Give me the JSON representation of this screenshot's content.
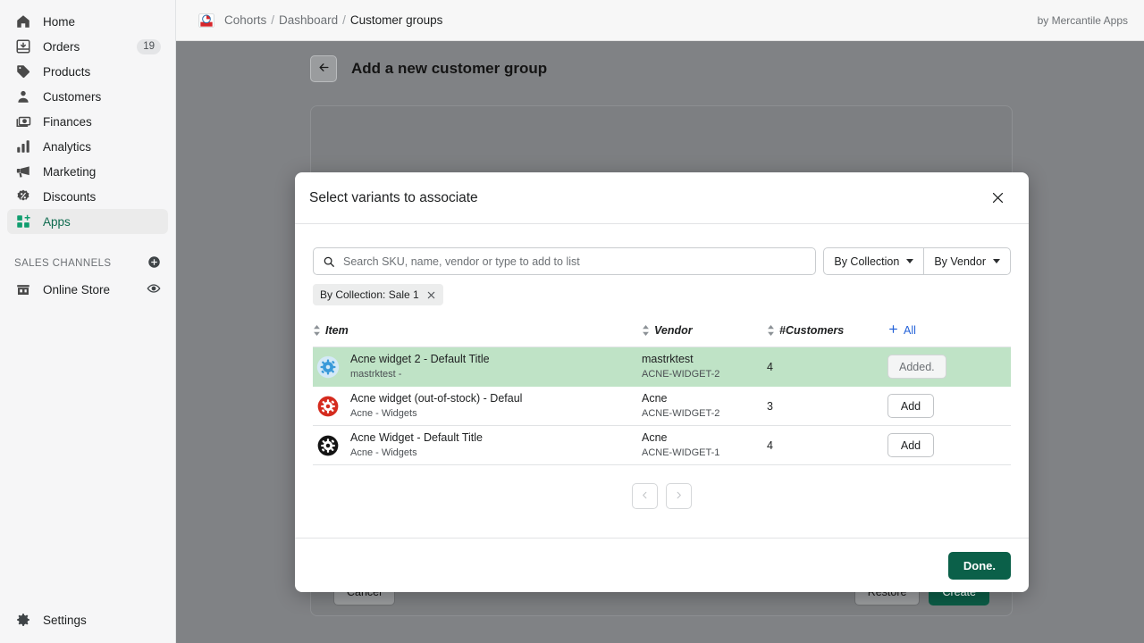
{
  "sidebar": {
    "items": [
      {
        "label": "Home",
        "icon": "home-icon",
        "badge": ""
      },
      {
        "label": "Orders",
        "icon": "orders-inbox-icon",
        "badge": "19"
      },
      {
        "label": "Products",
        "icon": "tag-icon",
        "badge": ""
      },
      {
        "label": "Customers",
        "icon": "person-icon",
        "badge": ""
      },
      {
        "label": "Finances",
        "icon": "banknote-icon",
        "badge": ""
      },
      {
        "label": "Analytics",
        "icon": "bar-chart-icon",
        "badge": ""
      },
      {
        "label": "Marketing",
        "icon": "megaphone-icon",
        "badge": ""
      },
      {
        "label": "Discounts",
        "icon": "discount-badge-icon",
        "badge": ""
      },
      {
        "label": "Apps",
        "icon": "apps-grid-plus-icon",
        "badge": ""
      }
    ],
    "section_label": "SALES CHANNELS",
    "channels": [
      {
        "label": "Online Store",
        "icon": "storefront-icon"
      }
    ],
    "settings": {
      "label": "Settings",
      "icon": "gear-icon"
    }
  },
  "topbar": {
    "brand_icon": "cohorts-logo-icon",
    "breadcrumb": {
      "root": "Cohorts",
      "middle": "Dashboard",
      "current": "Customer groups",
      "separator": "/"
    },
    "byline": "by Mercantile Apps"
  },
  "page": {
    "back_icon": "arrow-left-icon",
    "title": "Add a new customer group",
    "footer": {
      "cancel": "Cancel",
      "restore": "Restore",
      "create": "Create"
    }
  },
  "modal": {
    "title": "Select variants to associate",
    "close_icon": "close-icon",
    "search": {
      "placeholder": "Search SKU, name, vendor or type to add to list",
      "value": "",
      "icon": "search-icon"
    },
    "filters": [
      {
        "label": "By Collection",
        "icon": "chevron-down-icon"
      },
      {
        "label": "By Vendor",
        "icon": "chevron-down-icon"
      }
    ],
    "chips": [
      {
        "label": "By Collection: Sale 1",
        "remove_icon": "close-icon"
      }
    ],
    "table": {
      "columns": [
        {
          "key": "item",
          "label": "Item",
          "sortable": true
        },
        {
          "key": "vendor",
          "label": "Vendor",
          "sortable": true
        },
        {
          "key": "customers",
          "label": "#Customers",
          "sortable": true
        }
      ],
      "add_all": {
        "label": "All",
        "icon": "plus-icon"
      },
      "rows": [
        {
          "icon": "gear-icon",
          "icon_color": "#3a9ad9",
          "icon_bg": "#d4e9f7",
          "title": "Acne widget 2 - Default Title",
          "subtitle": "mastrktest -",
          "vendor": "mastrktest",
          "sku": "ACNE-WIDGET-2",
          "customers": "4",
          "action_label": "Added.",
          "added": true
        },
        {
          "icon": "gear-icon",
          "icon_color": "#ffffff",
          "icon_bg": "#d52b1e",
          "title": "Acne widget (out-of-stock) - Defaul",
          "subtitle": "Acne - Widgets",
          "vendor": "Acne",
          "sku": "ACNE-WIDGET-2",
          "customers": "3",
          "action_label": "Add",
          "added": false
        },
        {
          "icon": "gear-icon",
          "icon_color": "#ffffff",
          "icon_bg": "#141414",
          "title": "Acne Widget - Default Title",
          "subtitle": "Acne - Widgets",
          "vendor": "Acne",
          "sku": "ACNE-WIDGET-1",
          "customers": "4",
          "action_label": "Add",
          "added": false
        }
      ]
    },
    "pagination": {
      "prev_icon": "chevron-left-icon",
      "next_icon": "chevron-right-icon"
    },
    "done_label": "Done."
  },
  "colors": {
    "accent_green": "#0b6049",
    "link_blue": "#2563d9",
    "added_row": "#bfe3c6",
    "sidebar_bg": "#f6f6f7",
    "overlay": "#808285"
  }
}
